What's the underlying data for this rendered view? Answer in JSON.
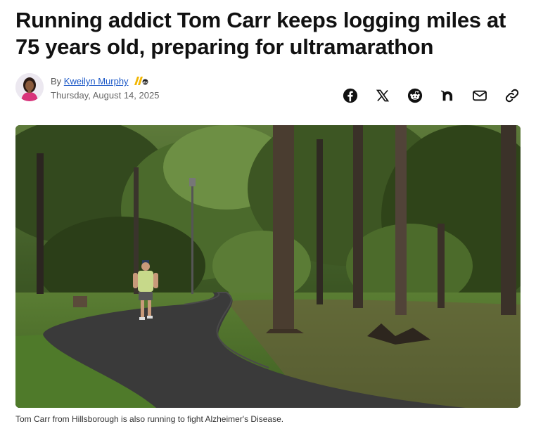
{
  "article": {
    "headline": "Running addict Tom Carr keeps logging miles at 75 years old, preparing for ultramarathon",
    "byline_prefix": "By",
    "author": "Kweilyn Murphy",
    "date": "Thursday, August 14, 2025",
    "image_caption": "Tom Carr from Hillsborough is also running to fight Alzheimer's Disease.",
    "image_alt": "Tom Carr running on a paved path in a wooded park"
  },
  "share": {
    "buttons": [
      {
        "icon": "facebook-icon",
        "label": "Share on Facebook"
      },
      {
        "icon": "x-icon",
        "label": "Share on X"
      },
      {
        "icon": "reddit-icon",
        "label": "Share on Reddit"
      },
      {
        "icon": "nextdoor-icon",
        "label": "Share on Nextdoor"
      },
      {
        "icon": "email-icon",
        "label": "Share via Email"
      },
      {
        "icon": "link-icon",
        "label": "Copy link"
      }
    ]
  },
  "colors": {
    "link": "#1a57c7",
    "headline": "#111111",
    "station_logo": "#f2b705"
  }
}
